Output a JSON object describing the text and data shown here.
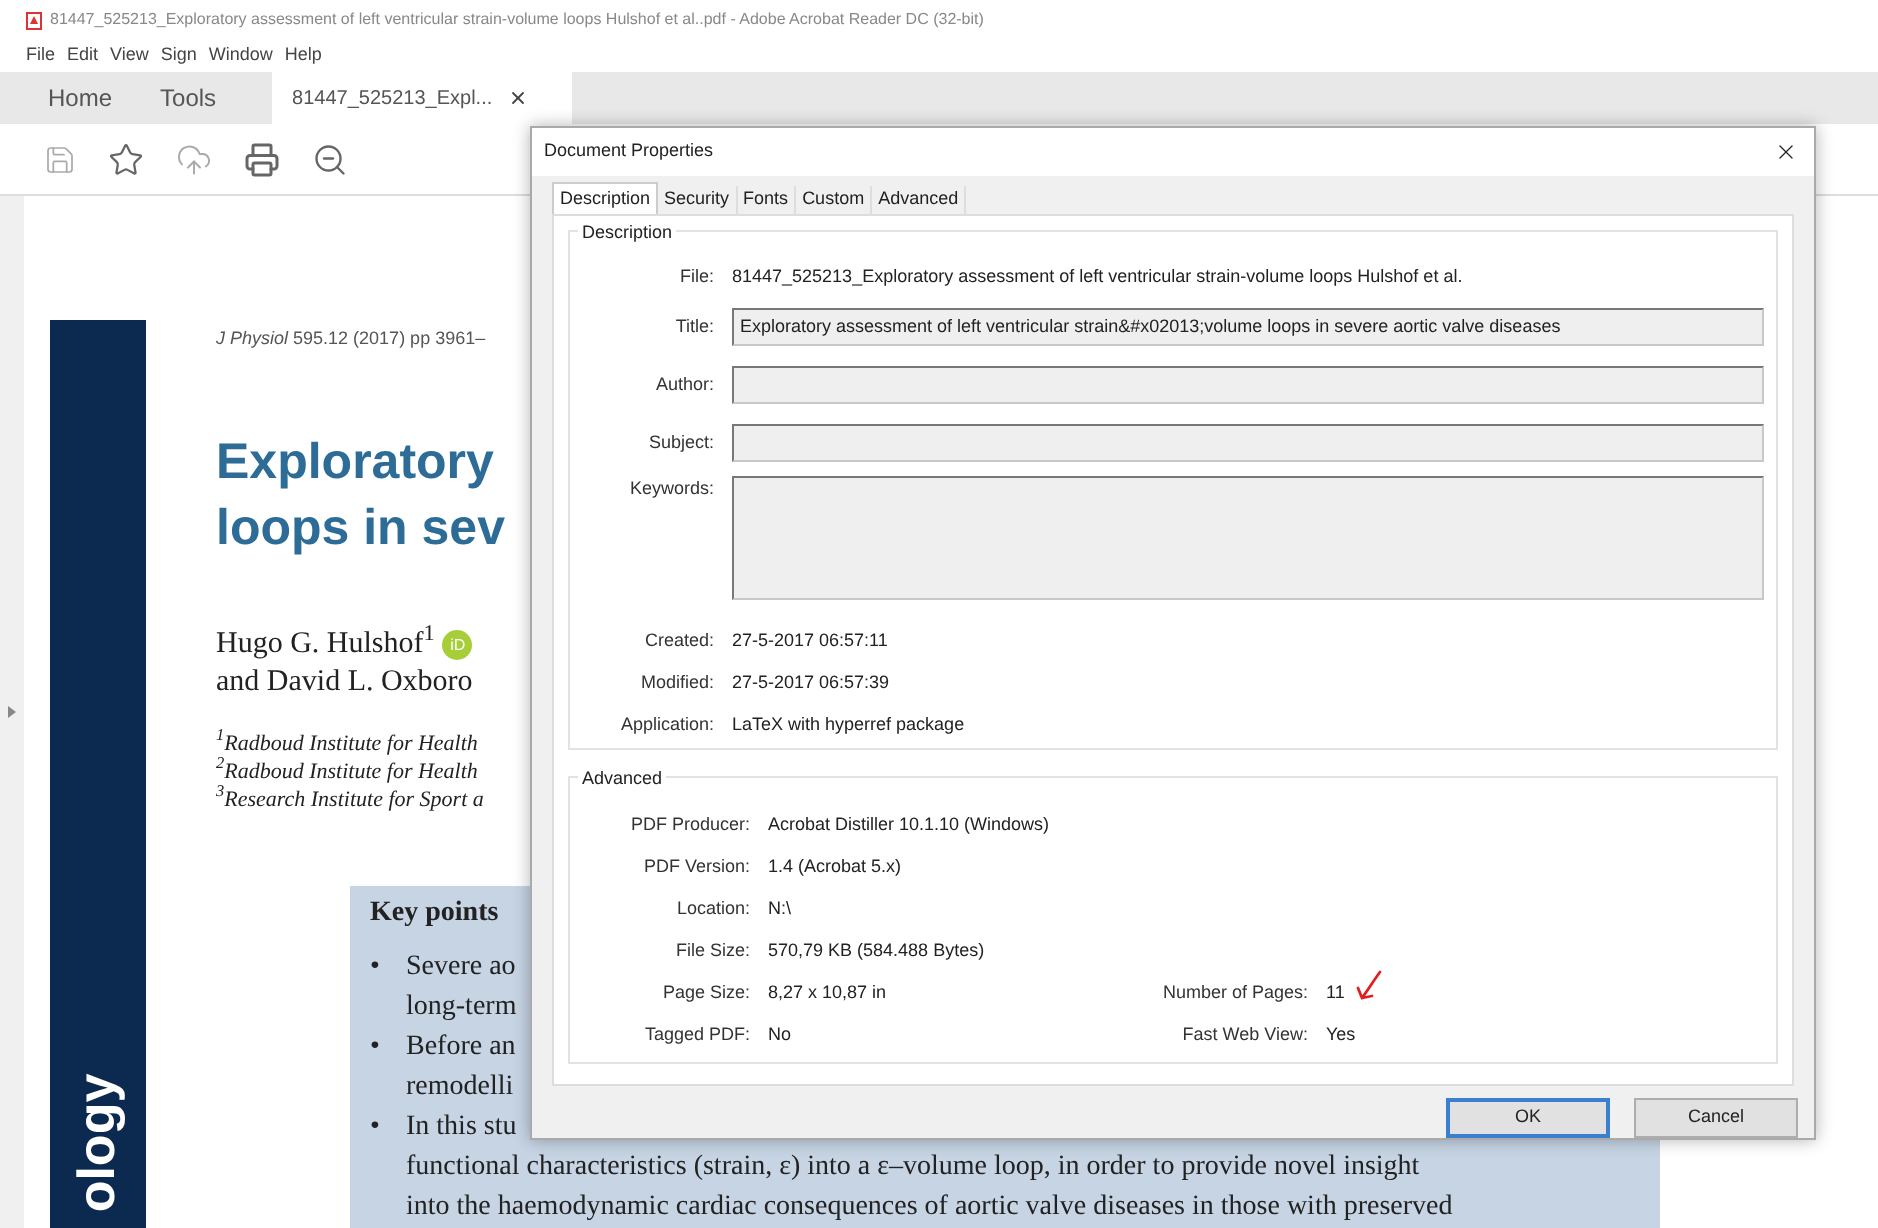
{
  "window": {
    "title": "81447_525213_Exploratory assessment of left ventricular strain-volume loops Hulshof et al..pdf - Adobe Acrobat Reader DC (32-bit)"
  },
  "menu": [
    "File",
    "Edit",
    "View",
    "Sign",
    "Window",
    "Help"
  ],
  "tabs": [
    {
      "label": "Home",
      "selected": false,
      "kind": "nav"
    },
    {
      "label": "Tools",
      "selected": false,
      "kind": "nav"
    },
    {
      "label": "81447_525213_Expl...",
      "selected": true,
      "kind": "document"
    }
  ],
  "document": {
    "running_head": "*J Physiol* 595.12 (2017) pp 3961–",
    "title_lines": [
      "Exploratory",
      "loops in sev"
    ],
    "authors": [
      "Hugo G. Hulshof$^{1}$",
      "and David L. Oxboro"
    ],
    "orcid": "iD",
    "affiliations": [
      "$^{1}$Radboud Institute for Health",
      "$^{2}$Radboud Institute for Health",
      "$^{3}$Research Institute for Sport a"
    ],
    "sidebar_text": "ology",
    "key_points": {
      "heading": "Key points",
      "items": [
        {
          "bullet": "•",
          "lines": [
            "Severe ao",
            "long-term"
          ]
        },
        {
          "bullet": "•",
          "lines": [
            "Before an",
            "remodelli"
          ]
        },
        {
          "bullet": "•",
          "lines": [
            "In this stu",
            "functional characteristics (strain, ε) into a ε–volume loop, in order to provide novel insight",
            "into the haemodynamic cardiac consequences of aortic valve diseases in those with preserved"
          ]
        }
      ]
    }
  },
  "dialog": {
    "title": "Document Properties",
    "tabs": [
      {
        "label": "Description",
        "selected": true
      },
      {
        "label": "Security",
        "selected": false
      },
      {
        "label": "Fonts",
        "selected": false
      },
      {
        "label": "Custom",
        "selected": false
      },
      {
        "label": "Advanced",
        "selected": false
      }
    ],
    "description": {
      "legend": "Description",
      "rows": [
        {
          "label": "File:",
          "value": "81447_525213_Exploratory assessment of left ventricular strain-volume loops Hulshof et al.",
          "kind": "text"
        },
        {
          "label": "Title:",
          "value": "Exploratory assessment of left ventricular strain&#x02013;volume loops in severe aortic valve diseases",
          "kind": "field"
        },
        {
          "label": "Author:",
          "kind": "field"
        },
        {
          "label": "Subject:",
          "kind": "field"
        },
        {
          "label": "Keywords:",
          "kind": "area"
        },
        {
          "label": "Created:",
          "value": "27-5-2017 06:57:11",
          "kind": "text"
        },
        {
          "label": "Modified:",
          "value": "27-5-2017 06:57:39",
          "kind": "text"
        },
        {
          "label": "Application:",
          "value": "LaTeX with hyperref package",
          "kind": "text"
        }
      ]
    },
    "advanced": {
      "legend": "Advanced",
      "rows": [
        {
          "label": "PDF Producer:",
          "value": "Acrobat Distiller 10.1.10 (Windows)"
        },
        {
          "label": "PDF Version:",
          "value": "1.4 (Acrobat 5.x)"
        },
        {
          "label": "Location:",
          "value": "N:\\"
        },
        {
          "label": "File Size:",
          "value": "570,79 KB (584.488 Bytes)"
        },
        {
          "label": "Page Size:",
          "value": "8,27 x 10,87 in",
          "label2": "Number of Pages:",
          "value2": "11"
        },
        {
          "label": "Tagged PDF:",
          "value": "No",
          "label2": "Fast Web View:",
          "value2": "Yes"
        }
      ]
    },
    "buttons": [
      {
        "label": "OK",
        "default": true
      },
      {
        "label": "Cancel",
        "default": false
      }
    ]
  }
}
